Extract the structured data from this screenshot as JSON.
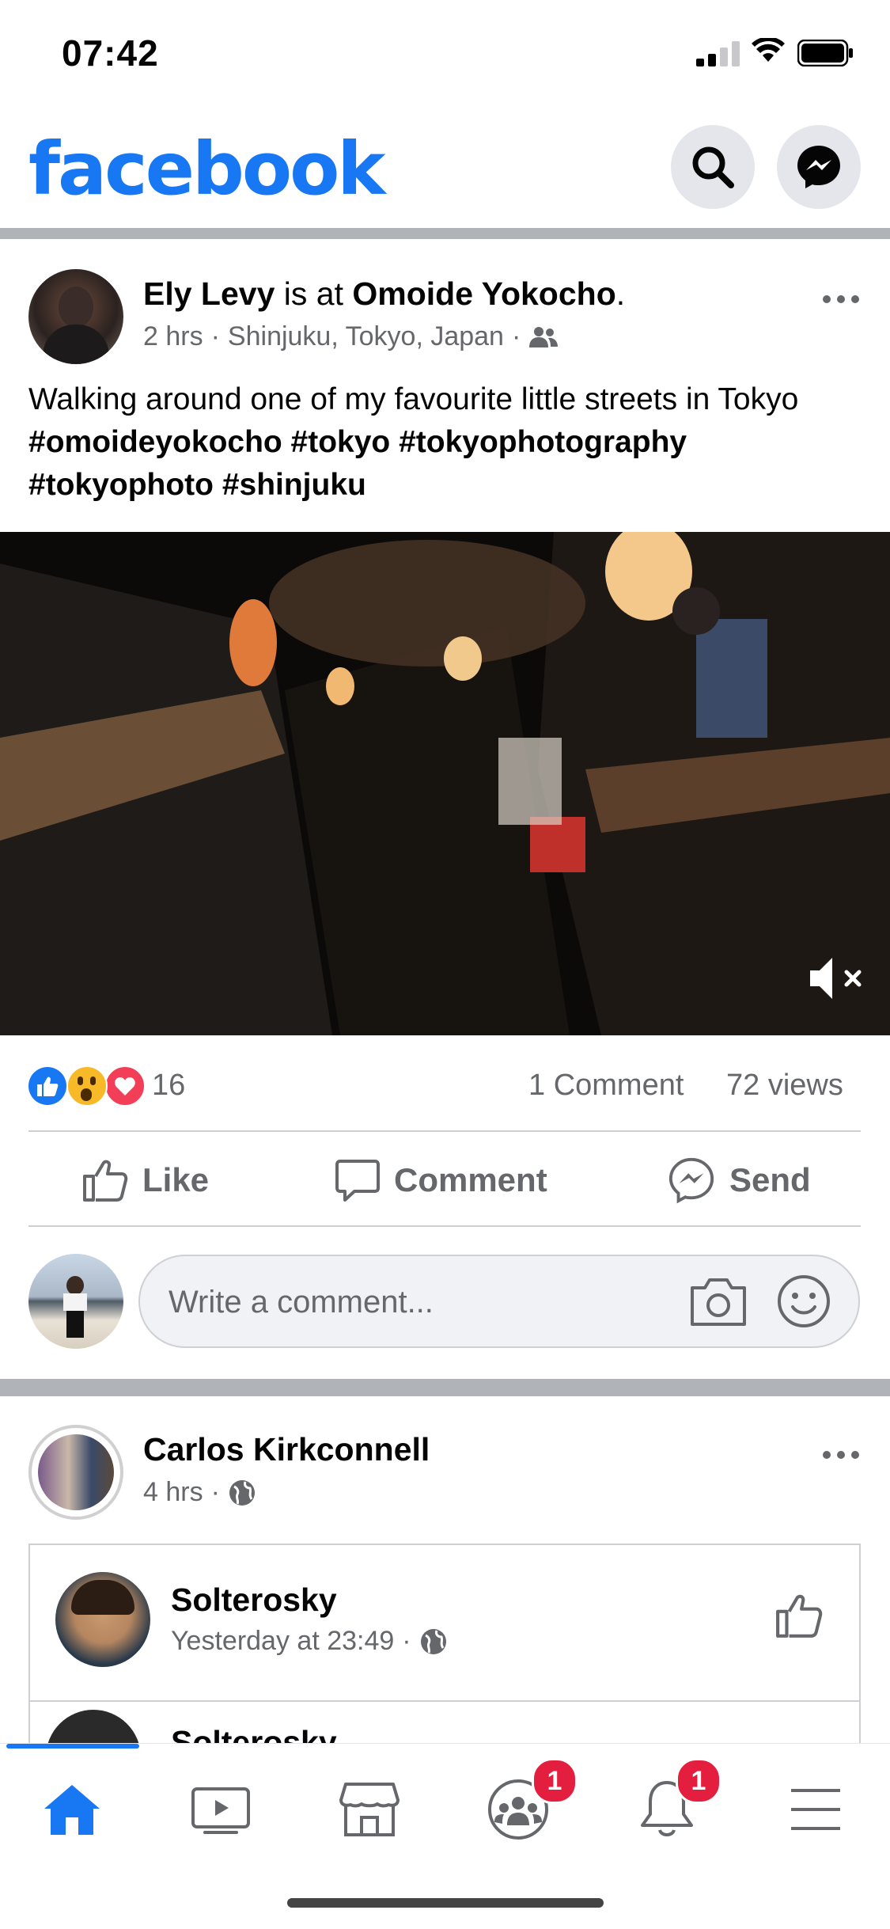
{
  "status_bar": {
    "time": "07:42"
  },
  "header": {
    "logo": "facebook",
    "search_icon": "search-icon",
    "messenger_icon": "messenger-icon"
  },
  "post1": {
    "author": "Ely Levy",
    "connector": " is at ",
    "place": "Omoide Yokocho",
    "period": ".",
    "time": "2 hrs",
    "location": "Shinjuku, Tokyo, Japan",
    "audience_icon": "friends-icon",
    "text_plain": "Walking around one of my favourite little streets in Tokyo ",
    "hashtags": "#omoideyokocho #tokyo #tokyophotography #tokyophoto #shinjuku",
    "mute_icon": "muted-speaker-icon",
    "reaction_count": "16",
    "comments": "1 Comment",
    "views": "72 views",
    "actions": {
      "like": "Like",
      "comment": "Comment",
      "send": "Send"
    },
    "comment_placeholder": "Write a comment..."
  },
  "post2": {
    "author": "Carlos Kirkconnell",
    "time": "4 hrs",
    "shared": {
      "author": "Solterosky",
      "time": "Yesterday at 23:49",
      "next_author": "Solterosky"
    }
  },
  "tabbar": {
    "tabs": [
      "home",
      "watch",
      "marketplace",
      "groups",
      "notifications",
      "menu"
    ],
    "groups_badge": "1",
    "notifications_badge": "1"
  },
  "colors": {
    "brand": "#1877F2",
    "badge": "#E41E3F",
    "text_secondary": "#65676B"
  }
}
